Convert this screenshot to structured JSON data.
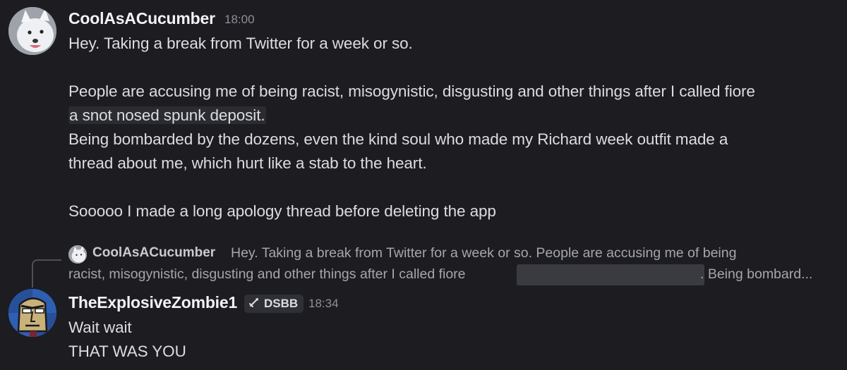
{
  "messages": [
    {
      "author": "CoolAsACucumber",
      "timestamp": "18:00",
      "avatar_icon": "arctic-fox-avatar",
      "lines": [
        "Hey. Taking a break from Twitter for a week or so.",
        "",
        "People are accusing me of being racist, misogynistic, disgusting and other things after I called fiore",
        "a snot nosed spunk deposit.",
        "Being bombarded by the dozens, even the kind soul who made my Richard week outfit made a",
        "thread about me, which hurt like a stab to the heart.",
        "",
        "Sooooo I made a long apology thread before deleting the app"
      ]
    },
    {
      "reply_to": {
        "author": "CoolAsACucumber",
        "preview_line1": "Hey. Taking a break from Twitter for a week or so.  People are accusing me of being",
        "preview_line2": "racist, misogynistic, disgusting and other things after I called fiore",
        "preview_tail": ". Being bombard..."
      },
      "author": "TheExplosiveZombie1",
      "tag": {
        "icon": "sword-icon",
        "label": "DSBB"
      },
      "timestamp": "18:34",
      "avatar_icon": "zombie-cartoon-avatar",
      "lines": [
        "Wait wait",
        "THAT WAS YOU"
      ]
    }
  ],
  "colors": {
    "background": "#1c1c21",
    "text": "#dcdde1",
    "author": "#f2f3f5",
    "muted": "#8e9099",
    "spoiler": "#3a3b41"
  }
}
